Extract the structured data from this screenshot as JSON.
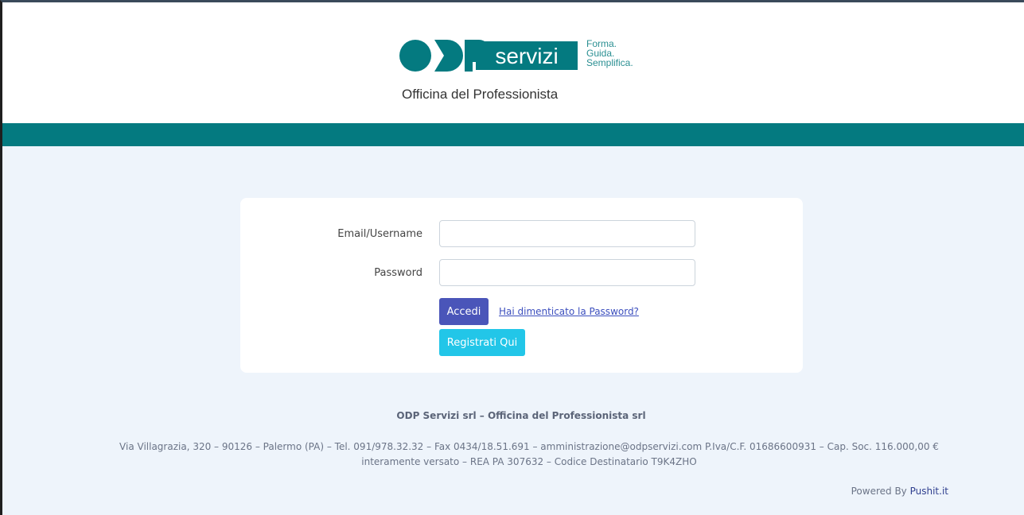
{
  "header": {
    "logo_text": "ODP servizi",
    "tagline": [
      "Forma.",
      "Guida.",
      "Semplifica."
    ],
    "subtitle": "Officina del Professionista",
    "brand_color": "#047a80"
  },
  "login": {
    "email_label": "Email/Username",
    "email_value": "",
    "password_label": "Password",
    "password_value": "",
    "submit_label": "Accedi",
    "forgot_label": "Hai dimenticato la Password?",
    "register_label": "Registrati Qui"
  },
  "footer": {
    "company": "ODP Servizi srl – Officina del Professionista srl",
    "address": "Via Villagrazia, 320 – 90126 – Palermo (PA) – Tel. 091/978.32.32 – Fax 0434/18.51.691 – amministrazione@odpservizi.com P.Iva/C.F. 01686600931 – Cap. Soc. 116.000,00 € interamente versato – REA PA 307632 – Codice Destinatario T9K4ZHO",
    "powered_prefix": "Powered By",
    "powered_brand": "Pushit.it"
  }
}
